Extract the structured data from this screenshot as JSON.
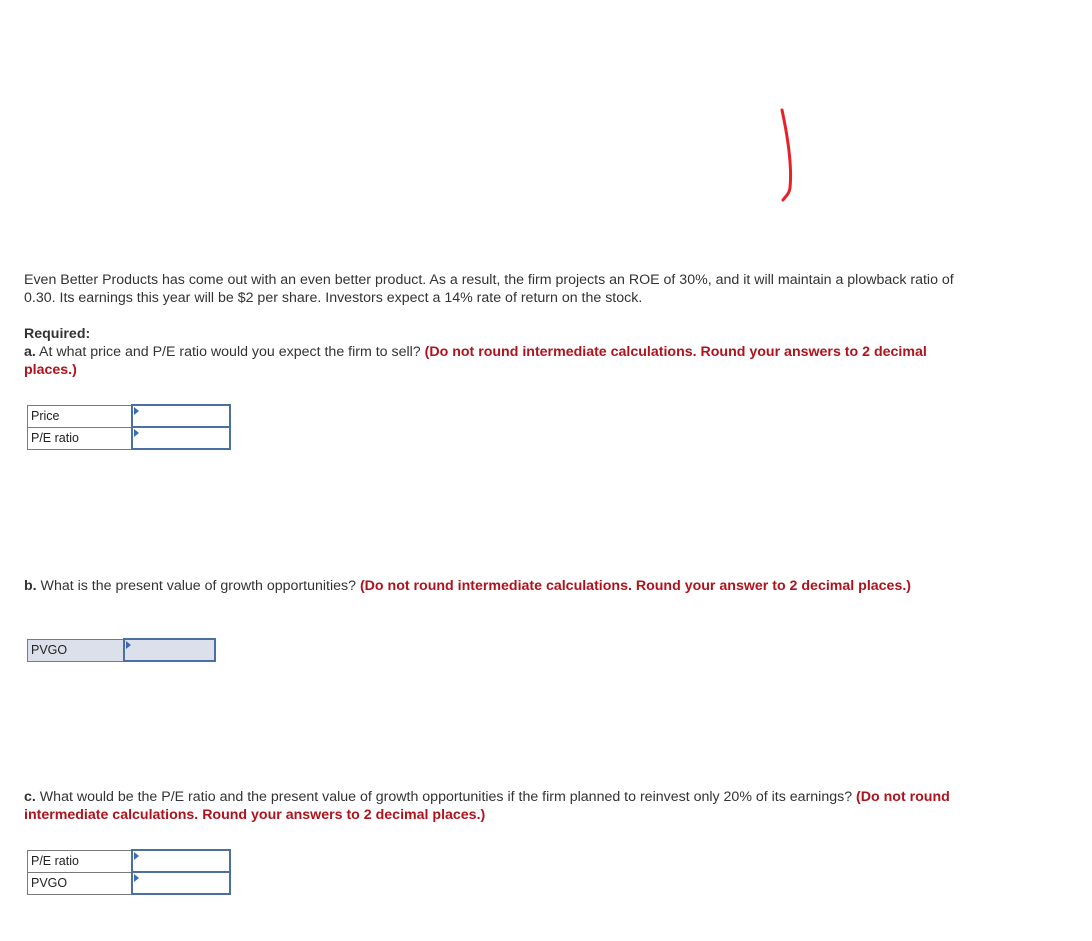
{
  "problem": {
    "text": "Even Better Products has come out with an even better product. As a result, the firm projects an ROE of 30%, and it will maintain a plowback ratio of 0.30. Its earnings this year will be $2 per share. Investors expect a 14% rate of return on the stock.",
    "required_label": "Required:"
  },
  "part_a": {
    "letter": "a.",
    "question": " At what price and P/E ratio would you expect the firm to sell? ",
    "hint": "(Do not round intermediate calculations. Round your answers to 2 decimal places.)",
    "rows": [
      {
        "label": "Price",
        "value": ""
      },
      {
        "label": "P/E ratio",
        "value": ""
      }
    ]
  },
  "part_b": {
    "letter": "b.",
    "question": " What is the present value of growth opportunities? ",
    "hint": "(Do not round intermediate calculations. Round your answer to 2 decimal places.)",
    "rows": [
      {
        "label": "PVGO",
        "value": ""
      }
    ]
  },
  "part_c": {
    "letter": "c.",
    "question": " What would be the P/E ratio and the present value of growth opportunities if the firm planned to reinvest only 20% of its earnings? ",
    "hint": "(Do not round intermediate calculations. Round your answers to 2 decimal places.)",
    "rows": [
      {
        "label": "P/E ratio",
        "value": ""
      },
      {
        "label": "PVGO",
        "value": ""
      }
    ]
  },
  "colors": {
    "hint": "#b0121b",
    "input_border": "#4a6fa0",
    "annotation": "#e8202a"
  }
}
